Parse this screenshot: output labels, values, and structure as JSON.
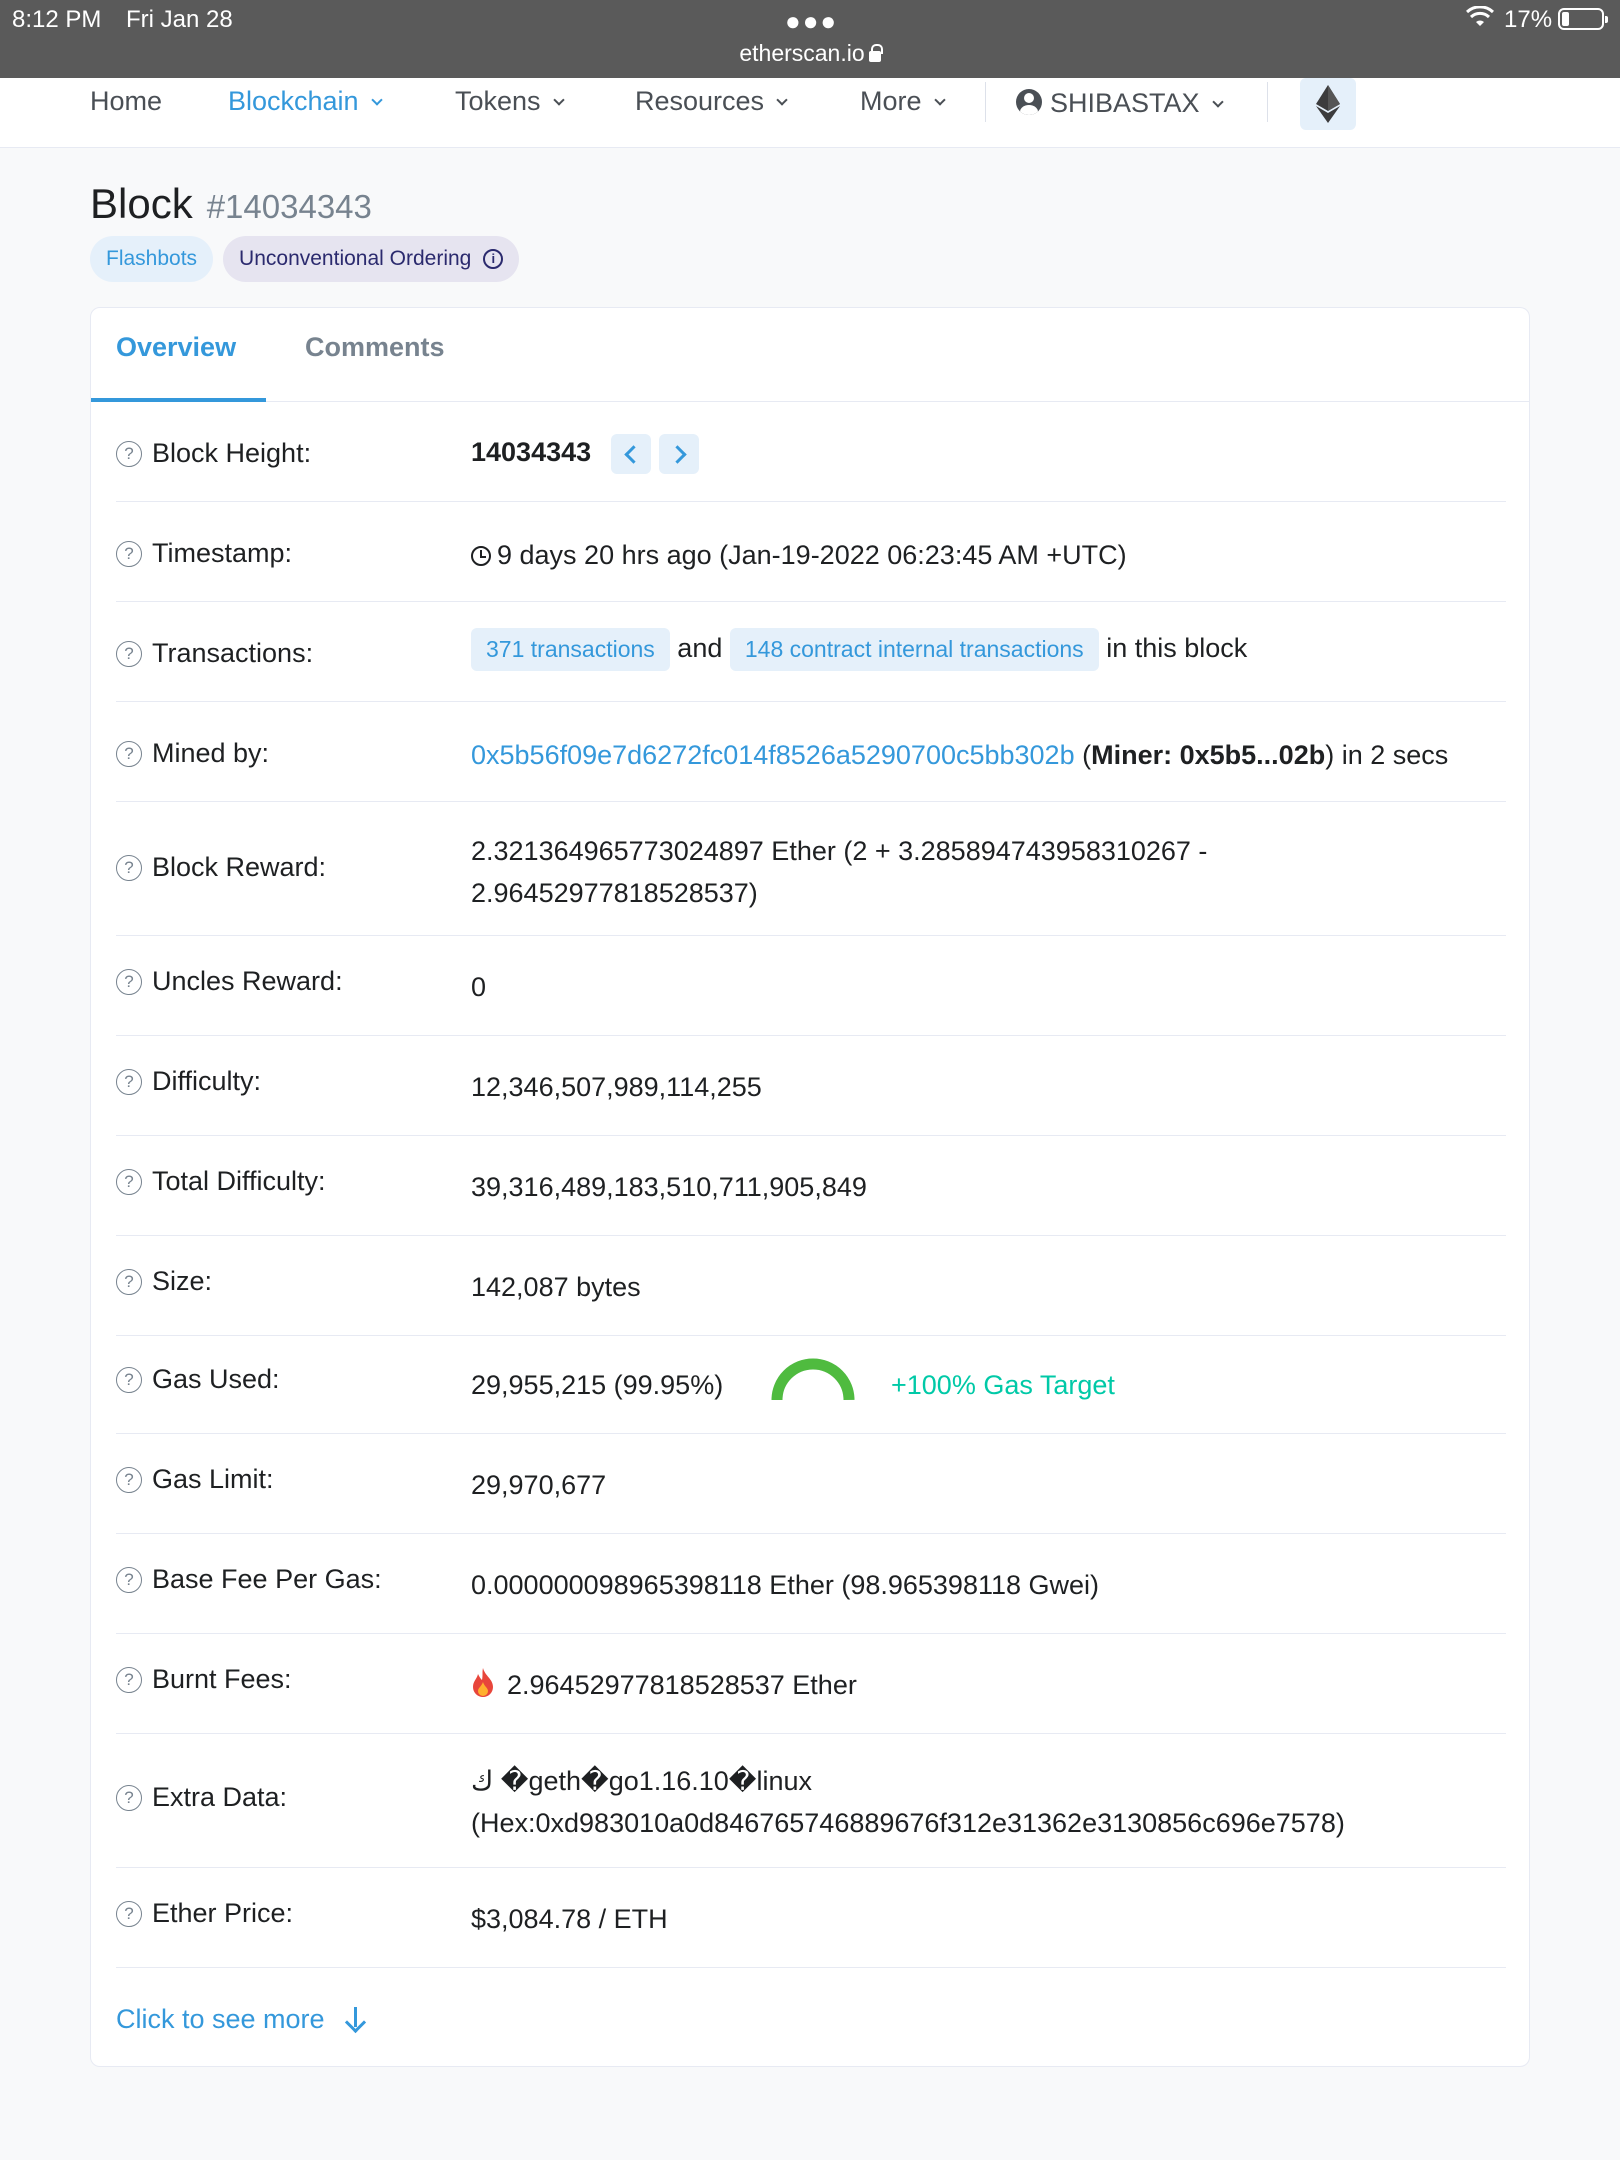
{
  "status_bar": {
    "time": "8:12 PM",
    "date": "Fri Jan 28",
    "url": "etherscan.io",
    "battery": "17%"
  },
  "nav": {
    "home": "Home",
    "blockchain": "Blockchain",
    "tokens": "Tokens",
    "resources": "Resources",
    "more": "More",
    "user": "SHIBASTAX"
  },
  "page": {
    "title": "Block",
    "block_number": "#14034343",
    "badge_flashbots": "Flashbots",
    "badge_unconventional": "Unconventional Ordering"
  },
  "tabs": {
    "overview": "Overview",
    "comments": "Comments"
  },
  "rows": {
    "block_height": {
      "label": "Block Height:",
      "value": "14034343"
    },
    "timestamp": {
      "label": "Timestamp:",
      "value": "9 days 20 hrs ago (Jan-19-2022 06:23:45 AM +UTC)"
    },
    "transactions": {
      "label": "Transactions:",
      "tx_link": "371 transactions",
      "and": "and",
      "internal_link": "148 contract internal transactions",
      "suffix": "in this block"
    },
    "mined_by": {
      "label": "Mined by:",
      "address": "0x5b56f09e7d6272fc014f8526a5290700c5bb302b",
      "miner_open": "(",
      "miner": "Miner: 0x5b5...02b",
      "suffix": ") in 2 secs"
    },
    "block_reward": {
      "label": "Block Reward:",
      "line1": "2.321364965773024897 Ether (2 + 3.285894743958310267 -",
      "line2": "2.96452977818528537)"
    },
    "uncles_reward": {
      "label": "Uncles Reward:",
      "value": "0"
    },
    "difficulty": {
      "label": "Difficulty:",
      "value": "12,346,507,989,114,255"
    },
    "total_difficulty": {
      "label": "Total Difficulty:",
      "value": "39,316,489,183,510,711,905,849"
    },
    "size": {
      "label": "Size:",
      "value": "142,087 bytes"
    },
    "gas_used": {
      "label": "Gas Used:",
      "value": "29,955,215 (99.95%)",
      "gauge_fraction": 0.9995,
      "target": "+100% Gas Target"
    },
    "gas_limit": {
      "label": "Gas Limit:",
      "value": "29,970,677"
    },
    "base_fee": {
      "label": "Base Fee Per Gas:",
      "value": "0.000000098965398118 Ether (98.965398118 Gwei)"
    },
    "burnt_fees": {
      "label": "Burnt Fees:",
      "value": "2.96452977818528537 Ether"
    },
    "extra_data": {
      "label": "Extra Data:",
      "line1": "ك �geth�go1.16.10�linux",
      "line2": "(Hex:0xd983010a0d846765746889676f312e31362e3130856c696e7578)"
    },
    "ether_price": {
      "label": "Ether Price:",
      "value": "$3,084.78 / ETH"
    }
  },
  "see_more": "Click to see more",
  "colors": {
    "accent": "#3498db",
    "gas_gauge": "#4fbb3f",
    "gas_target": "#00c9a7",
    "fire": "#e8463b"
  },
  "icons": [
    "wifi-icon",
    "lock-icon",
    "battery-icon",
    "user-circle-icon",
    "ethereum-icon",
    "info-icon",
    "question-icon",
    "clock-icon",
    "fire-icon",
    "arrow-down-icon",
    "chevron-left-icon",
    "chevron-right-icon"
  ]
}
